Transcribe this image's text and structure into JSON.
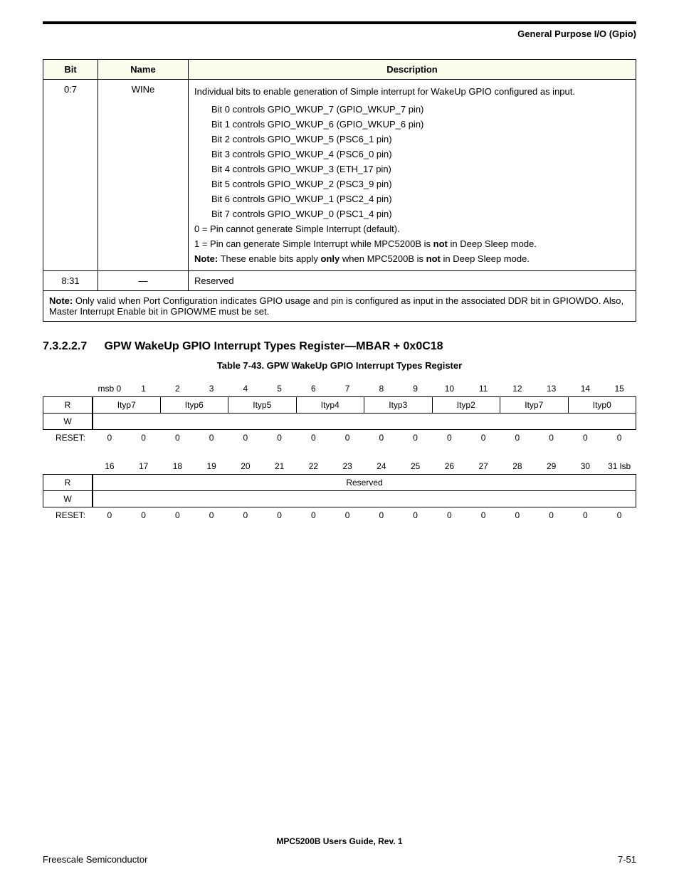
{
  "header": {
    "section_title": "General Purpose I/O (Gpio)"
  },
  "desc_table": {
    "headers": {
      "bit": "Bit",
      "name": "Name",
      "desc": "Description"
    },
    "row1": {
      "bit": "0:7",
      "name": "WINe",
      "intro": "Individual bits to enable generation of Simple interrupt for WakeUp GPIO configured as input.",
      "bits": [
        "Bit 0 controls GPIO_WKUP_7 (GPIO_WKUP_7 pin)",
        "Bit 1 controls GPIO_WKUP_6 (GPIO_WKUP_6 pin)",
        "Bit 2 controls GPIO_WKUP_5 (PSC6_1 pin)",
        "Bit 3 controls GPIO_WKUP_4 (PSC6_0 pin)",
        "Bit 4 controls GPIO_WKUP_3 (ETH_17 pin)",
        "Bit 5 controls GPIO_WKUP_2 (PSC3_9 pin)",
        "Bit 6 controls GPIO_WKUP_1 (PSC2_4 pin)",
        "Bit 7 controls GPIO_WKUP_0 (PSC1_4 pin)"
      ],
      "zero": "0 = Pin cannot generate Simple Interrupt (default).",
      "one_pre": "1 = Pin can generate Simple Interrupt while MPC5200B is ",
      "one_bold": "not",
      "one_post": " in Deep Sleep mode.",
      "note_lbl": "Note:",
      "note_pre": "  These enable bits apply ",
      "note_b1": "only",
      "note_mid": " when MPC5200B is ",
      "note_b2": "not",
      "note_post": " in Deep Sleep mode."
    },
    "row2": {
      "bit": "8:31",
      "name": "—",
      "desc": "Reserved"
    },
    "footnote_lbl": "Note:",
    "footnote": "  Only valid when Port Configuration indicates GPIO usage and pin is configured as input in the associated DDR bit in GPIOWDO. Also, Master Interrupt Enable bit in GPIOWME must be set."
  },
  "section": {
    "num": "7.3.2.2.7",
    "title": "GPW WakeUp GPIO Interrupt Types Register—MBAR + 0x0C18"
  },
  "caption": "Table 7-43. GPW WakeUp GPIO Interrupt Types Register",
  "chart_data": {
    "type": "table",
    "register_name": "GPW WakeUp GPIO Interrupt Types Register",
    "offset": "MBAR + 0x0C18",
    "width_bits": 32,
    "rows": [
      {
        "bit_headers": [
          "msb 0",
          "1",
          "2",
          "3",
          "4",
          "5",
          "6",
          "7",
          "8",
          "9",
          "10",
          "11",
          "12",
          "13",
          "14",
          "15"
        ],
        "R_fields": [
          {
            "name": "Ityp7",
            "span": 2
          },
          {
            "name": "Ityp6",
            "span": 2
          },
          {
            "name": "Ityp5",
            "span": 2
          },
          {
            "name": "Ityp4",
            "span": 2
          },
          {
            "name": "Ityp3",
            "span": 2
          },
          {
            "name": "Ityp2",
            "span": 2
          },
          {
            "name": "Ityp7",
            "span": 2
          },
          {
            "name": "Ityp0",
            "span": 2
          }
        ],
        "W_fields": [
          {
            "name": "",
            "span": 16
          }
        ],
        "reset": [
          "0",
          "0",
          "0",
          "0",
          "0",
          "0",
          "0",
          "0",
          "0",
          "0",
          "0",
          "0",
          "0",
          "0",
          "0",
          "0"
        ]
      },
      {
        "bit_headers": [
          "16",
          "17",
          "18",
          "19",
          "20",
          "21",
          "22",
          "23",
          "24",
          "25",
          "26",
          "27",
          "28",
          "29",
          "30",
          "31 lsb"
        ],
        "R_fields": [
          {
            "name": "Reserved",
            "span": 16
          }
        ],
        "W_fields": [
          {
            "name": "",
            "span": 16
          }
        ],
        "reset": [
          "0",
          "0",
          "0",
          "0",
          "0",
          "0",
          "0",
          "0",
          "0",
          "0",
          "0",
          "0",
          "0",
          "0",
          "0",
          "0"
        ]
      }
    ],
    "labels": {
      "R": "R",
      "W": "W",
      "RESET": "RESET:"
    }
  },
  "footer": {
    "center": "MPC5200B Users Guide, Rev. 1",
    "left": "Freescale Semiconductor",
    "right": "7-51"
  }
}
